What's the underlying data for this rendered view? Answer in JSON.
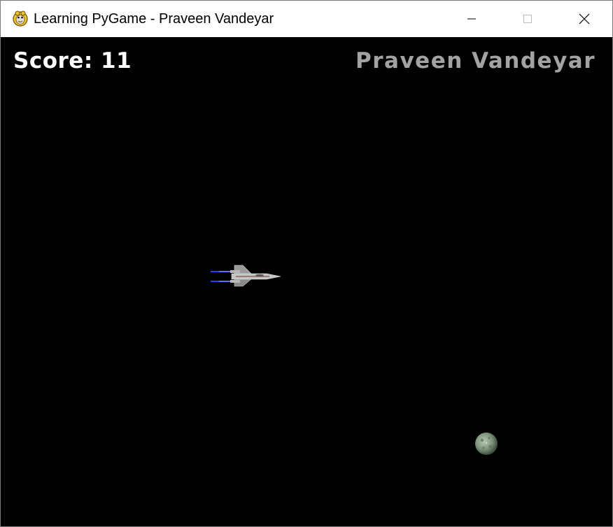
{
  "window": {
    "title": "Learning PyGame - Praveen Vandeyar",
    "controls": {
      "minimize": "minimize",
      "maximize": "maximize",
      "close": "close"
    }
  },
  "hud": {
    "score_text": "Score: 11",
    "author_text": "Praveen Vandeyar"
  },
  "sprites": {
    "player": "jet-fighter-icon",
    "enemy": "asteroid-icon"
  },
  "colors": {
    "background": "#000000",
    "score": "#ffffff",
    "author": "#a3a3a3",
    "exhaust": "#2a3dff"
  }
}
